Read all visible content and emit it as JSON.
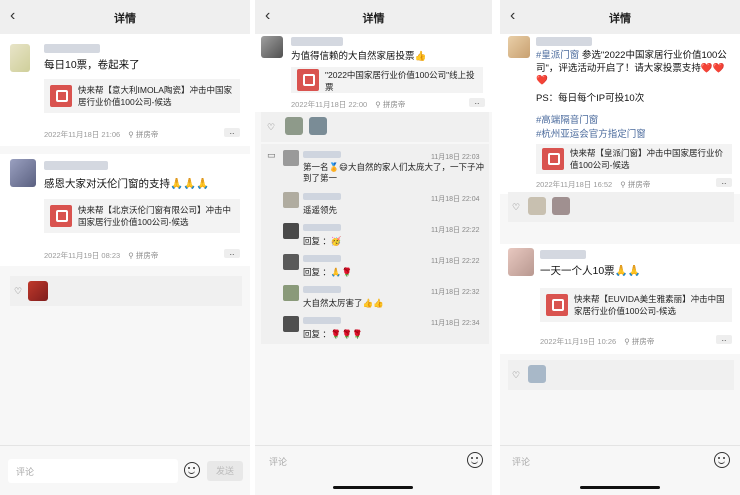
{
  "header": {
    "title": "详情",
    "back": "‹"
  },
  "footer": {
    "placeholder": "评论",
    "send": "发送"
  },
  "panel1": {
    "posts": [
      {
        "text": "每日10票，卷起来了",
        "card": "快来帮【意大利IMOLA陶瓷】冲击中国家居行业价值100公司-候选",
        "time": "2022年11月18日 21:06",
        "source": "拼房帝"
      },
      {
        "text": "感恩大家对沃伦门窗的支持🙏🙏🙏",
        "card": "快来帮【北京沃伦门窗有限公司】冲击中国家居行业价值100公司-候选",
        "time": "2022年11月19日 08:23",
        "source": "拼房帝"
      }
    ]
  },
  "panel2": {
    "post": {
      "text": "为值得信赖的大自然家居投票👍",
      "card": "\"2022中国家居行业价值100公司\"线上投票",
      "time": "2022年11月18日 22:00",
      "source": "拼房帝"
    },
    "comments": [
      {
        "time": "11月18日 22:03",
        "text": "第一名🏅😄大自然的家人们太庞大了，一下子冲到了第一"
      },
      {
        "time": "11月18日 22:04",
        "text": "遥遥领先"
      },
      {
        "time": "11月18日 22:22",
        "text": "回复 ：🥳"
      },
      {
        "time": "11月18日 22:22",
        "text": "回复 ：🙏🌹"
      },
      {
        "time": "11月18日 22:32",
        "text": "大自然太厉害了👍👍"
      },
      {
        "time": "11月18日 22:34",
        "text": "回复 ：🌹🌹🌹"
      }
    ]
  },
  "panel3": {
    "posts": [
      {
        "text_tag": "#皇派门窗",
        "text": " 参选\"2022中国家居行业价值100公司\"，评选活动开启了！请大家投票支持❤️❤️❤️",
        "text2": "PS：每日每个IP可投10次",
        "tag2": "#高端隔音门窗",
        "tag3": "#杭州亚运会官方指定门窗",
        "card": "快来帮【皇派门窗】冲击中国家居行业价值100公司-候选",
        "time": "2022年11月18日 16:52",
        "source": "拼房帝"
      },
      {
        "text": "一天一个人10票🙏🙏",
        "card": "快来帮【EUVIDA美生雅素丽】冲击中国家居行业价值100公司-候选",
        "time": "2022年11月19日 10:26",
        "source": "拼房帝"
      }
    ]
  },
  "colors": {
    "accent": "#d9534f",
    "link": "#4a6a9c",
    "bg": "#f7f7f7"
  },
  "icons": {
    "heart": "heart-icon",
    "comment": "comment-icon",
    "emoji": "emoji-icon",
    "back": "back-arrow-icon"
  }
}
